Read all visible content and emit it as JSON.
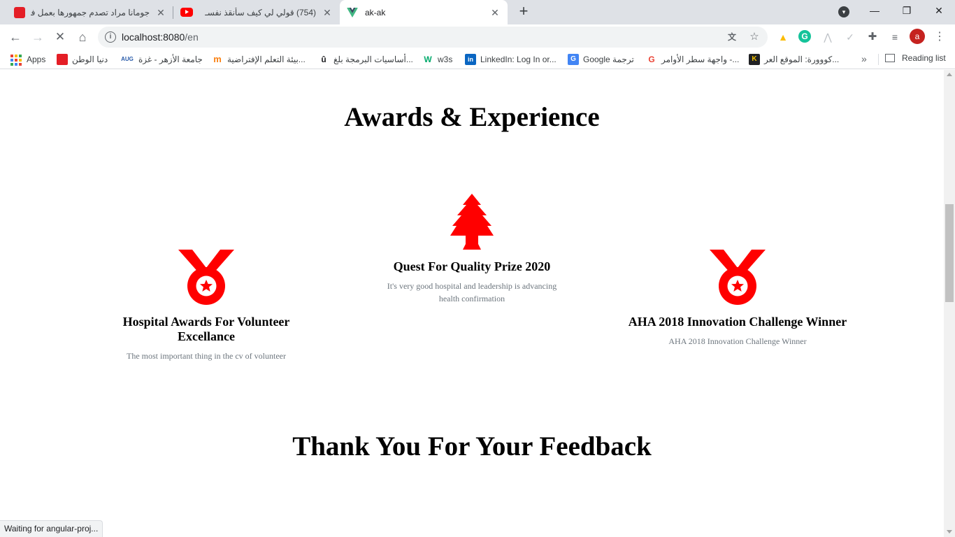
{
  "browser": {
    "tabs": [
      {
        "title": "جومانا مراد تصدم جمهورها بعمل فنـ",
        "favicon": "red-news-icon"
      },
      {
        "title": "(754) قولي لي كيف سأنقذ نفسـ",
        "favicon": "youtube-icon"
      },
      {
        "title": "ak-ak",
        "favicon": "vue-icon"
      }
    ],
    "new_tab": "+",
    "window_controls": {
      "minimize": "—",
      "restore": "❐",
      "close": "✕"
    },
    "address": {
      "host": "localhost:8080",
      "path": "/en"
    },
    "avatar_letter": "a",
    "bookmarks": [
      {
        "label": "Apps",
        "icon": "apps-grid-icon"
      },
      {
        "label": "دنيا الوطن",
        "icon": "dunya-icon",
        "color": "#e41e26"
      },
      {
        "label": "جامعة الأزهر - غزة",
        "icon": "aug-icon",
        "badge": "AUG",
        "color": "#2a5caa"
      },
      {
        "label": "بيئة التعلم الإفتراضية...",
        "icon": "moodle-icon",
        "badge": "m",
        "color": "#f98012"
      },
      {
        "label": "أساسيات البرمجة بلغ...",
        "icon": "u-icon",
        "badge": "û",
        "color": "#ffffff"
      },
      {
        "label": "w3s",
        "icon": "w3s-icon",
        "badge": "W",
        "color": "#04aa6d"
      },
      {
        "label": "LinkedIn: Log In or...",
        "icon": "linkedin-icon",
        "badge": "in",
        "color": "#0a66c2"
      },
      {
        "label": "Google ترجمة",
        "icon": "google-translate-icon",
        "badge": "G",
        "color": "#4285f4"
      },
      {
        "label": "واجهة سطر الأوامر -...",
        "icon": "google-icon",
        "badge": "G",
        "color": "#ffffff"
      },
      {
        "label": "كووورة: الموقع العر...",
        "icon": "kooora-icon",
        "badge": "K",
        "color": "#f2c200"
      }
    ],
    "reading_list": "Reading list",
    "more": "»",
    "status": "Waiting for angular-proj..."
  },
  "page": {
    "awards_title": "Awards & Experience",
    "feedback_title": "Thank You For Your Feedback",
    "accent_color": "#ff0000",
    "awards": [
      {
        "icon": "medal-icon",
        "name": "Hospital Awards For Volunteer Excellance",
        "desc": "The most important thing in the cv of volunteer"
      },
      {
        "icon": "tree-icon",
        "name": "Quest For Quality Prize 2020",
        "desc": "It's very good hospital and leadership is advancing health confirmation"
      },
      {
        "icon": "medal-icon",
        "name": "AHA 2018 Innovation Challenge Winner",
        "desc": "AHA 2018 Innovation Challenge Winner"
      }
    ]
  }
}
